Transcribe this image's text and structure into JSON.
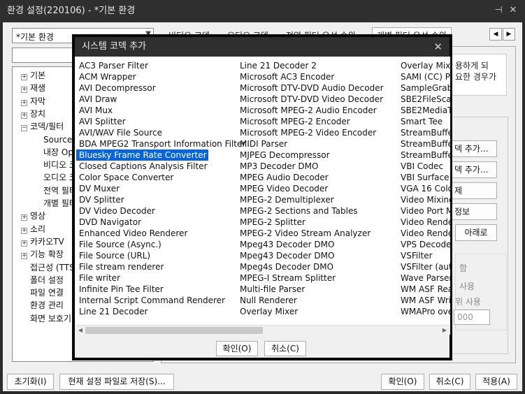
{
  "window": {
    "title": "환경 설정(220106) - *기본 환경",
    "pin_glyph": "⊣",
    "close_glyph": "✕"
  },
  "left": {
    "combo_value": "*기본 환경",
    "tree": [
      {
        "label": "기본",
        "expander": "+",
        "level": 0
      },
      {
        "label": "재생",
        "expander": "+",
        "level": 0
      },
      {
        "label": "자막",
        "expander": "+",
        "level": 0
      },
      {
        "label": "장치",
        "expander": "+",
        "level": 0
      },
      {
        "label": "코덱/필터",
        "expander": "−",
        "level": 0
      },
      {
        "label": "Source/S",
        "expander": "",
        "level": 1
      },
      {
        "label": "내장 Ope",
        "expander": "",
        "level": 1
      },
      {
        "label": "비디오 코",
        "expander": "",
        "level": 1
      },
      {
        "label": "오디오 코",
        "expander": "",
        "level": 1
      },
      {
        "label": "전역 필터",
        "expander": "",
        "level": 1
      },
      {
        "label": "개별 필터",
        "expander": "",
        "level": 1
      },
      {
        "label": "영상",
        "expander": "+",
        "level": 0
      },
      {
        "label": "소리",
        "expander": "+",
        "level": 0
      },
      {
        "label": "카카오TV",
        "expander": "+",
        "level": 0
      },
      {
        "label": "기능 확장",
        "expander": "+",
        "level": 0
      },
      {
        "label": "접근성 (TTS",
        "expander": "",
        "level": 0
      },
      {
        "label": "폴더 설정",
        "expander": "",
        "level": 0
      },
      {
        "label": "파일 연결",
        "expander": "",
        "level": 0
      },
      {
        "label": "환경 관리",
        "expander": "",
        "level": 0
      },
      {
        "label": "화면 보호기",
        "expander": "",
        "level": 0
      }
    ]
  },
  "right": {
    "tabs": [
      "비디오 코덱",
      "오디오 코덱",
      "전역 필터 우선 순위",
      "개별 필터 우선 순위"
    ],
    "tab_prev": "◀",
    "tab_next": "▶",
    "info_line1": "용하게 되",
    "info_line2": "요한 경우가",
    "btn_codec_add": "덱 추가...",
    "btn_filter_add": "덱 추가...",
    "btn_delete": "제",
    "btn_info": "정보",
    "btn_down": "아래로",
    "opt1": "함",
    "opt2": "사용",
    "opt3": "위 사용",
    "input_value": "000"
  },
  "bottom": {
    "reset": "초기화(I)",
    "save_current": "현재 설정 파일로 저장(S)...",
    "ok": "확인(O)",
    "cancel": "취소(C)",
    "apply": "적용(A)"
  },
  "modal": {
    "title": "시스템 코덱 추가",
    "close_glyph": "✕",
    "selected": "Bluesky Frame Rate Converter",
    "col1": [
      "AC3 Parser Filter",
      "ACM Wrapper",
      "AVI Decompressor",
      "AVI Draw",
      "AVI Mux",
      "AVI Splitter",
      "AVI/WAV File Source",
      "BDA MPEG2 Transport Information Filter",
      "Bluesky Frame Rate Converter",
      "Closed Captions Analysis Filter",
      "Color Space Converter",
      "DV Muxer",
      "DV Splitter",
      "DV Video Decoder",
      "DVD Navigator",
      "Enhanced Video Renderer",
      "File Source (Async.)",
      "File Source (URL)",
      "File stream renderer",
      "File writer",
      "Infinite Pin Tee Filter",
      "Internal Script Command Renderer",
      "Line 21 Decoder"
    ],
    "col2": [
      "Line 21 Decoder 2",
      "Microsoft AC3 Encoder",
      "Microsoft DTV-DVD Audio Decoder",
      "Microsoft DTV-DVD Video Decoder",
      "Microsoft MPEG-2 Audio Encoder",
      "Microsoft MPEG-2 Encoder",
      "Microsoft MPEG-2 Video Encoder",
      "MIDI Parser",
      "MJPEG Decompressor",
      "MP3 Decoder DMO",
      "MPEG Audio Decoder",
      "MPEG Video Decoder",
      "MPEG-2 Demultiplexer",
      "MPEG-2 Sections and Tables",
      "MPEG-2 Splitter",
      "MPEG-2 Video Stream Analyzer",
      "Mpeg43 Decoder DMO",
      "Mpeg43 Decoder DMO",
      "Mpeg4s Decoder DMO",
      "MPEG-I Stream Splitter",
      "Multi-file Parser",
      "Null Renderer",
      "Overlay Mixer"
    ],
    "col3": [
      "Overlay Mixe",
      "SAMI (CC) Pa",
      "SampleGrabb",
      "SBE2FileScan",
      "SBE2MediaTy",
      "Smart Tee",
      "StreamBuffer",
      "StreamBuffer",
      "StreamBuffer",
      "VBI Codec",
      "VBI Surface A",
      "VGA 16 Colo",
      "Video Mixing",
      "Video Port M",
      "Video Rende",
      "Video Rende",
      "VPS Decoder",
      "VSFilter",
      "VSFilter (auto",
      "Wave Parser",
      "WM ASF Rea",
      "WM ASF Writ",
      "WMAPro ove"
    ],
    "ok": "확인(O)",
    "cancel": "취소(C)",
    "scroll_left": "◀",
    "scroll_right": "▶"
  }
}
